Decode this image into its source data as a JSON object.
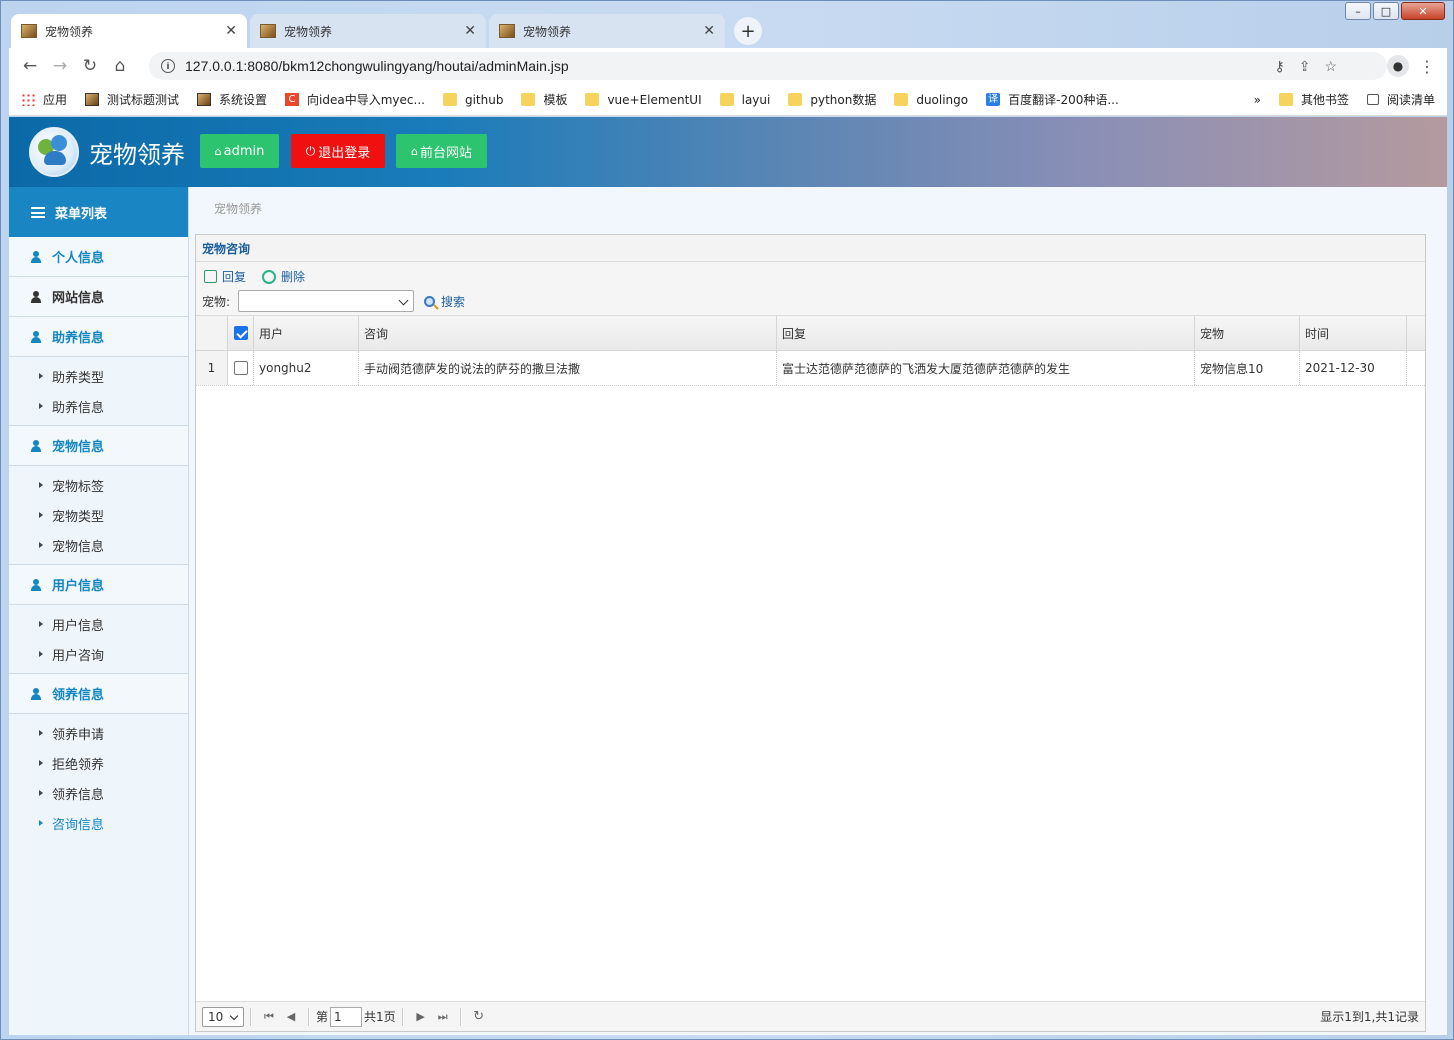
{
  "browser": {
    "tabs": [
      {
        "title": "宠物领养"
      },
      {
        "title": "宠物领养"
      },
      {
        "title": "宠物领养"
      }
    ],
    "url": "127.0.0.1:8080/bkm12chongwulingyang/houtai/adminMain.jsp",
    "bookmarks": [
      {
        "label": "应用",
        "icon": "apps-icon"
      },
      {
        "label": "测试标题测试",
        "icon": "image-icon"
      },
      {
        "label": "系统设置",
        "icon": "image-icon"
      },
      {
        "label": "向idea中导入myec...",
        "icon": "c-icon"
      },
      {
        "label": "github",
        "icon": "folder-icon"
      },
      {
        "label": "模板",
        "icon": "folder-icon"
      },
      {
        "label": "vue+ElementUI",
        "icon": "folder-icon"
      },
      {
        "label": "layui",
        "icon": "folder-icon"
      },
      {
        "label": "python数据",
        "icon": "folder-icon"
      },
      {
        "label": "duolingo",
        "icon": "folder-icon"
      },
      {
        "label": "百度翻译-200种语...",
        "icon": "translate-icon"
      }
    ],
    "bookmarks_more": "»",
    "other_bookmarks": "其他书签",
    "reading_list": "阅读清单"
  },
  "header": {
    "brand": "宠物领养",
    "admin_button": "admin",
    "logout_button": "退出登录",
    "frontend_button": "前台网站"
  },
  "sidebar": {
    "title": "菜单列表",
    "sections": [
      {
        "label": "个人信息",
        "items": []
      },
      {
        "label": "网站信息",
        "items": []
      },
      {
        "label": "助养信息",
        "items": [
          "助养类型",
          "助养信息"
        ]
      },
      {
        "label": "宠物信息",
        "items": [
          "宠物标签",
          "宠物类型",
          "宠物信息"
        ]
      },
      {
        "label": "用户信息",
        "items": [
          "用户信息",
          "用户咨询"
        ]
      },
      {
        "label": "领养信息",
        "items": [
          "领养申请",
          "拒绝领养",
          "领养信息",
          "咨询信息"
        ]
      }
    ],
    "selected_item": "咨询信息"
  },
  "breadcrumb": "宠物领养",
  "panel": {
    "title": "宠物咨询",
    "reply_button": "回复",
    "delete_button": "删除",
    "filter_label": "宠物:",
    "filter_value": "",
    "search_button": "搜索",
    "columns": [
      "用户",
      "咨询",
      "回复",
      "宠物",
      "时间"
    ],
    "rows": [
      {
        "num": "1",
        "user": "yonghu2",
        "question": "手动阀范德萨发的说法的萨芬的撒旦法撒",
        "reply": "富士达范德萨范德萨的飞洒发大厦范德萨范德萨的发生",
        "pet": "宠物信息10",
        "time": "2021-12-30"
      }
    ]
  },
  "pager": {
    "page_size": "10",
    "page_prefix": "第",
    "page_value": "1",
    "page_suffix": "共1页",
    "info": "显示1到1,共1记录"
  }
}
